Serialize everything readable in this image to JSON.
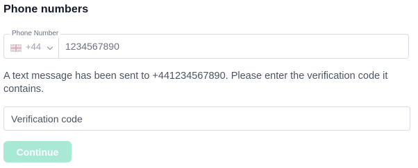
{
  "section": {
    "title": "Phone numbers"
  },
  "phone_field": {
    "label": "Phone Number",
    "country_flag_icon": "uk-flag-icon",
    "dial_code": "+44",
    "value": "1234567890"
  },
  "message": {
    "text": "A text message has been sent to +441234567890. Please enter the verification code it contains."
  },
  "verification_field": {
    "placeholder": "Verification code",
    "value": ""
  },
  "continue_button": {
    "label": "Continue",
    "enabled": false
  },
  "colors": {
    "button_disabled_bg": "#a7e9d4",
    "border": "#d9dde3",
    "text_muted": "#6b7280"
  }
}
